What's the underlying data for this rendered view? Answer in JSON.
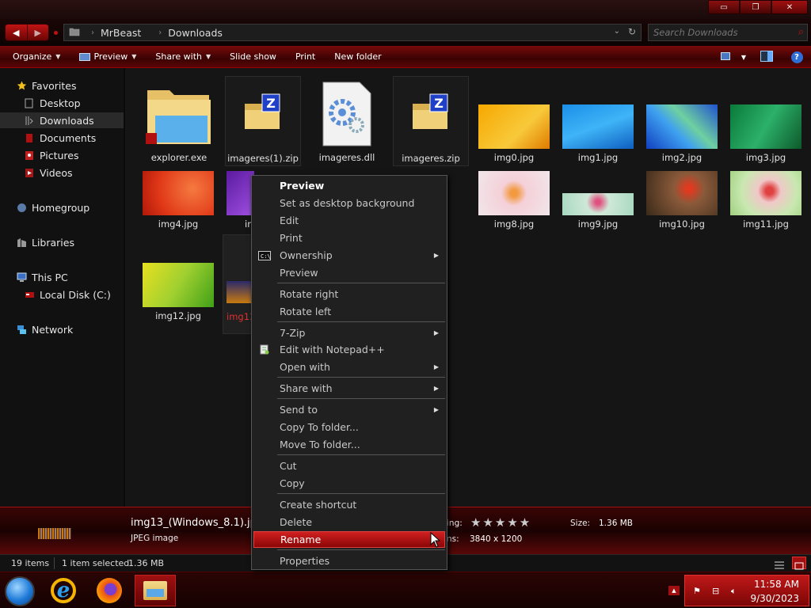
{
  "window": {
    "minimize": "▭",
    "restore": "❐",
    "close": "✕"
  },
  "nav_buttons": {
    "back": "◀",
    "forward": "▶"
  },
  "address": {
    "crumbs": [
      "MrBeast",
      "Downloads"
    ],
    "dropdown": "⌄",
    "refresh": "↻"
  },
  "search": {
    "placeholder": "Search Downloads"
  },
  "toolbar": {
    "organize": "Organize",
    "preview": "Preview",
    "share_with": "Share with",
    "slide_show": "Slide show",
    "print": "Print",
    "new_folder": "New folder",
    "help": "?"
  },
  "nav": {
    "favorites": "Favorites",
    "desktop": "Desktop",
    "downloads": "Downloads",
    "documents": "Documents",
    "pictures": "Pictures",
    "videos": "Videos",
    "homegroup": "Homegroup",
    "libraries": "Libraries",
    "this_pc": "This PC",
    "local_disk": "Local Disk (C:)",
    "network": "Network"
  },
  "files": [
    {
      "name": "explorer.exe",
      "kind": "folder"
    },
    {
      "name": "imageres(1).zip",
      "kind": "zip"
    },
    {
      "name": "imageres.dll",
      "kind": "dll"
    },
    {
      "name": "imageres.zip",
      "kind": "zip"
    },
    {
      "name": "img0.jpg",
      "kind": "image"
    },
    {
      "name": "img1.jpg",
      "kind": "image"
    },
    {
      "name": "img2.jpg",
      "kind": "image"
    },
    {
      "name": "img3.jpg",
      "kind": "image"
    },
    {
      "name": "img4.jpg",
      "kind": "image"
    },
    {
      "name": "im",
      "kind": "image"
    },
    {
      "name": "img8.jpg",
      "kind": "image"
    },
    {
      "name": "img9.jpg",
      "kind": "image"
    },
    {
      "name": "img10.jpg",
      "kind": "image"
    },
    {
      "name": "img11.jpg",
      "kind": "image"
    },
    {
      "name": "img12.jpg",
      "kind": "image"
    },
    {
      "name": "img13",
      "kind": "image"
    }
  ],
  "context_menu": {
    "preview": "Preview",
    "set_background": "Set as desktop background",
    "edit": "Edit",
    "print": "Print",
    "ownership": "Ownership",
    "preview2": "Preview",
    "rotate_right": "Rotate right",
    "rotate_left": "Rotate left",
    "seven_zip": "7-Zip",
    "edit_notepad": "Edit with Notepad++",
    "open_with": "Open with",
    "share_with": "Share with",
    "send_to": "Send to",
    "copy_to": "Copy To folder...",
    "move_to": "Move To folder...",
    "cut": "Cut",
    "copy": "Copy",
    "create_shortcut": "Create shortcut",
    "delete": "Delete",
    "rename": "Rename",
    "properties": "Properties"
  },
  "details": {
    "name": "img13_(Windows_8.1).jp",
    "type": "JPEG image",
    "rating_label": "ing:",
    "rating_stars": 0,
    "stars": "★★★★★",
    "dimensions_label": "ns:",
    "dimensions": "3840 x 1200",
    "size_label": "Size:",
    "size": "1.36 MB"
  },
  "status": {
    "count": "19 items",
    "selected": "1 item selected",
    "size": "1.36 MB"
  },
  "clock": {
    "time": "11:58 AM",
    "date": "9/30/2023"
  },
  "colors": {
    "accent": "#c01414",
    "highlight": "#d02020",
    "background": "#151515"
  }
}
